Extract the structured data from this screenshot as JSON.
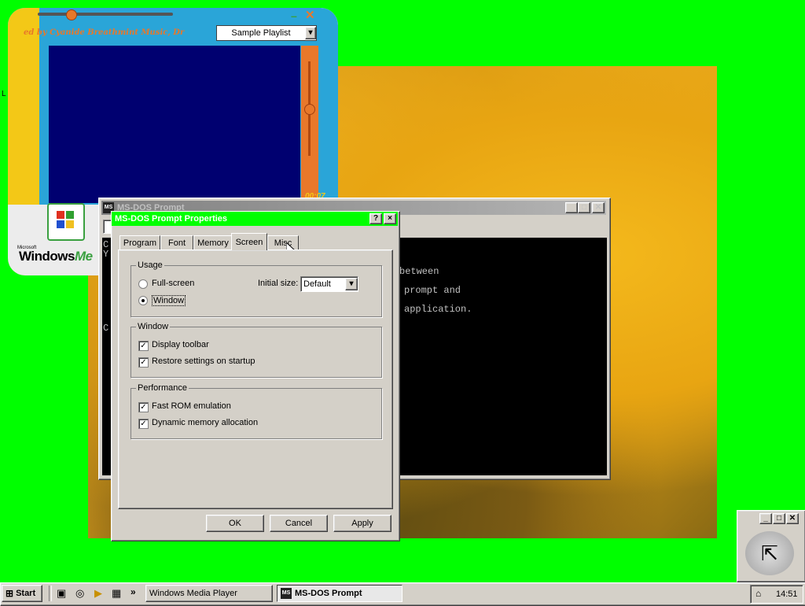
{
  "wallpaper": {
    "description_color": "#e8a512"
  },
  "media_player": {
    "credit_text": "ed by Cyanide Breathmint Music, Dr",
    "playlist_selected": "Sample Playlist",
    "time": "00:07",
    "logo_windows": "Windows",
    "logo_me": "Me",
    "logo_small": "Microsoft"
  },
  "side_fragment": "L",
  "dos_window": {
    "title": "MS-DOS Prompt",
    "terminal_lines": [
      "between",
      "prompt and",
      "application."
    ],
    "left_chars": [
      "C",
      "Y",
      "",
      "C",
      "",
      "",
      ""
    ]
  },
  "dialog": {
    "title": "MS-DOS Prompt Properties",
    "help_btn": "?",
    "close_btn": "×",
    "tabs": [
      "Program",
      "Font",
      "Memory",
      "Screen",
      "Misc"
    ],
    "active_tab": "Screen",
    "usage": {
      "label": "Usage",
      "fullscreen": "Full-screen",
      "window": "Window",
      "selected": "Window",
      "initial_size_label": "Initial size:",
      "initial_size_value": "Default"
    },
    "window_group": {
      "label": "Window",
      "display_toolbar": "Display toolbar",
      "restore_settings": "Restore settings on startup"
    },
    "performance": {
      "label": "Performance",
      "fast_rom": "Fast ROM emulation",
      "dynamic_memory": "Dynamic memory allocation"
    },
    "buttons": {
      "ok": "OK",
      "cancel": "Cancel",
      "apply": "Apply"
    },
    "checkbox_mark": "✓"
  },
  "taskbar": {
    "start": "Start",
    "tasks": [
      {
        "label": "Windows Media Player"
      },
      {
        "label": "MS-DOS Prompt"
      }
    ],
    "chevron": "»",
    "clock": "14:51"
  },
  "colors": {
    "desktop": "#00ff00",
    "face": "#d4d0c8",
    "dos_bg": "#000000",
    "wmp_screen": "#000070"
  }
}
